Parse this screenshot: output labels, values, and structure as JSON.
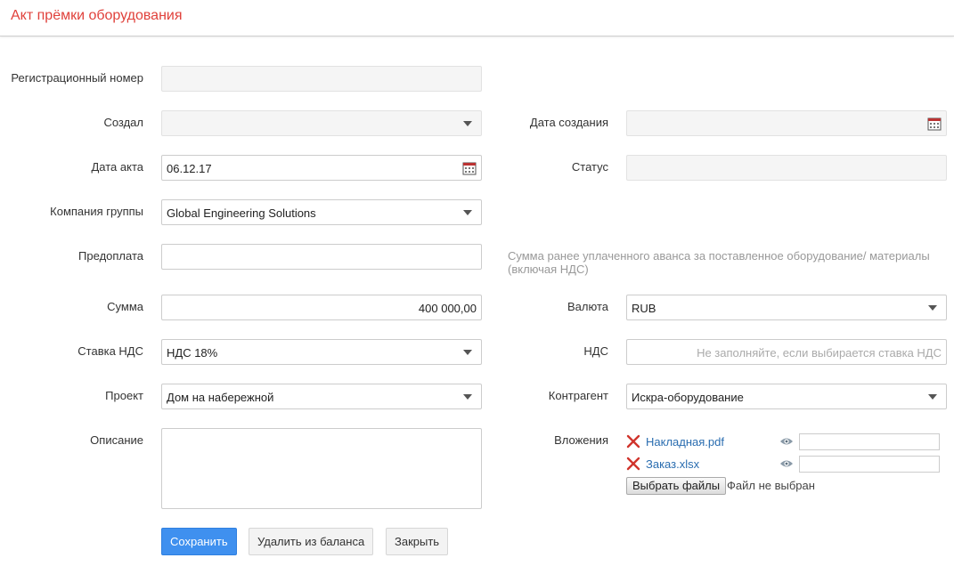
{
  "header": {
    "title": "Акт прёмки оборудования"
  },
  "form": {
    "reg_number": {
      "label": "Регистрационный номер",
      "value": ""
    },
    "created_by": {
      "label": "Создал",
      "value": ""
    },
    "created_date": {
      "label": "Дата создания",
      "value": ""
    },
    "act_date": {
      "label": "Дата акта",
      "value": "06.12.17"
    },
    "status": {
      "label": "Статус",
      "value": ""
    },
    "company": {
      "label": "Компания группы",
      "value": "Global Engineering Solutions"
    },
    "prepayment": {
      "label": "Предоплата",
      "value": "",
      "hint": "Сумма ранее уплаченного аванса за поставленное оборудование/ материалы (включая НДС)"
    },
    "amount": {
      "label": "Сумма",
      "value": "400 000,00"
    },
    "currency": {
      "label": "Валюта",
      "value": "RUB"
    },
    "vat_rate": {
      "label": "Ставка НДС",
      "value": "НДС 18%"
    },
    "vat": {
      "label": "НДС",
      "value": "",
      "placeholder": "Не заполняйте, если выбирается ставка НДС"
    },
    "project": {
      "label": "Проект",
      "value": "Дом на набережной"
    },
    "counterparty": {
      "label": "Контрагент",
      "value": "Искра-оборудование"
    },
    "description": {
      "label": "Описание",
      "value": ""
    },
    "attachments": {
      "label": "Вложения",
      "files": [
        {
          "name": "Накладная.pdf",
          "comment": ""
        },
        {
          "name": "Заказ.xlsx",
          "comment": ""
        }
      ],
      "choose_button": "Выбрать файлы",
      "no_file_text": "Файл не выбран"
    }
  },
  "actions": {
    "save": "Сохранить",
    "remove_from_balance": "Удалить из баланса",
    "close": "Закрыть"
  },
  "colors": {
    "title": "#e0413b",
    "primary_button": "#3f90ef",
    "link": "#2a6db0",
    "remove_icon": "#d0342c"
  }
}
